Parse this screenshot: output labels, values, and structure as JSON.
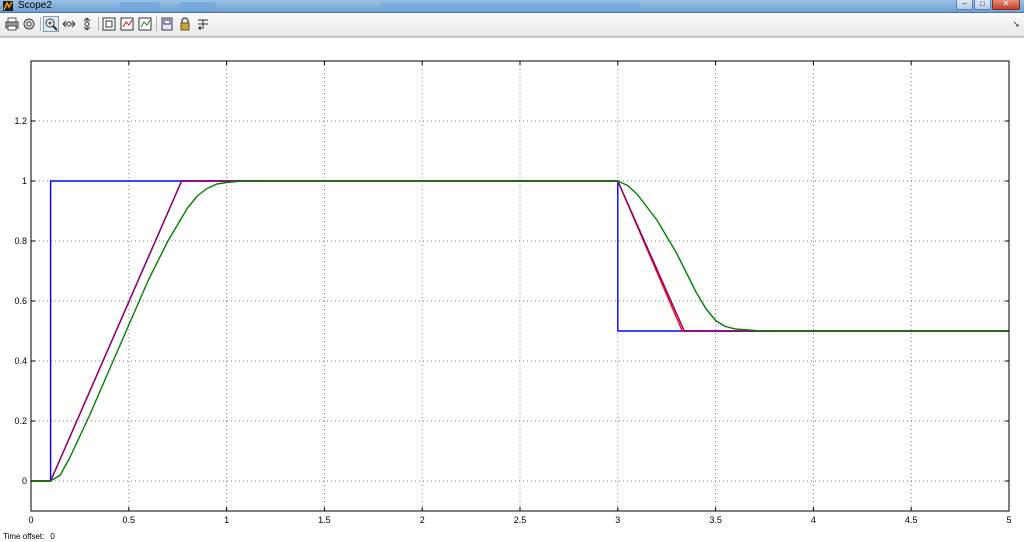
{
  "window": {
    "title": "Scope2",
    "controls": [
      "–",
      "□",
      "✕"
    ]
  },
  "toolbar": {
    "buttons": [
      {
        "icon": "print-icon",
        "tooltip": "Print"
      },
      {
        "icon": "parameters-icon",
        "tooltip": "Parameters"
      },
      {
        "icon": "zoom-icon",
        "tooltip": "Zoom",
        "active": true
      },
      {
        "icon": "zoom-x-icon",
        "tooltip": "Zoom X-axis"
      },
      {
        "icon": "zoom-y-icon",
        "tooltip": "Zoom Y-axis"
      },
      {
        "icon": "autoscale-icon",
        "tooltip": "Autoscale"
      },
      {
        "icon": "save-axes-icon",
        "tooltip": "Save current axes settings"
      },
      {
        "icon": "restore-axes-icon",
        "tooltip": "Restore saved axes settings"
      },
      {
        "icon": "floating-scope-icon",
        "tooltip": "Floating scope"
      },
      {
        "icon": "lock-axes-icon",
        "tooltip": "Lock axes selection"
      },
      {
        "icon": "signal-selector-icon",
        "tooltip": "Signal selection"
      }
    ]
  },
  "status": {
    "time_offset_label": "Time offset:",
    "time_offset_value": "0"
  },
  "chart_data": {
    "type": "line",
    "title": "",
    "xlabel": "",
    "ylabel": "",
    "xlim": [
      0,
      5
    ],
    "ylim": [
      -0.1,
      1.4
    ],
    "xticks": [
      "0",
      "0.5",
      "1",
      "1.5",
      "2",
      "2.5",
      "3",
      "3.5",
      "4",
      "4.5",
      "5"
    ],
    "yticks": [
      "0",
      "0.2",
      "0.4",
      "0.6",
      "0.8",
      "1",
      "1.2"
    ],
    "xtick_values": [
      0,
      0.5,
      1,
      1.5,
      2,
      2.5,
      3,
      3.5,
      4,
      4.5,
      5
    ],
    "ytick_values": [
      0,
      0.2,
      0.4,
      0.6,
      0.8,
      1,
      1.2
    ],
    "grid": true,
    "grid_style": "dotted",
    "background": "#ffffff",
    "series": [
      {
        "color": "#0000ff",
        "x": [
          0,
          0.1,
          0.1,
          3.0,
          3.0,
          5.0
        ],
        "y": [
          0,
          0,
          1,
          1,
          0.5,
          0.5
        ]
      },
      {
        "color": "#ff0000",
        "x": [
          0,
          0.1,
          0.77,
          3.0,
          3.33,
          5.0
        ],
        "y": [
          0,
          0,
          1,
          1,
          0.5,
          0.5
        ]
      },
      {
        "color": "#800080",
        "x": [
          0,
          0.1,
          0.77,
          1.2,
          3.0,
          3.34,
          3.75,
          5.0
        ],
        "y": [
          0,
          0,
          1,
          1,
          1,
          0.5,
          0.5,
          0.5
        ]
      },
      {
        "color": "#008000",
        "x": [
          0,
          0.1,
          0.15,
          0.2,
          0.3,
          0.4,
          0.5,
          0.6,
          0.7,
          0.8,
          0.85,
          0.9,
          0.95,
          1.0,
          1.05,
          1.1,
          1.2,
          3.0,
          3.05,
          3.1,
          3.2,
          3.3,
          3.4,
          3.45,
          3.5,
          3.55,
          3.6,
          3.7,
          3.75,
          5.0
        ],
        "y": [
          0,
          0,
          0.02,
          0.08,
          0.22,
          0.37,
          0.52,
          0.67,
          0.8,
          0.91,
          0.95,
          0.975,
          0.99,
          0.995,
          0.998,
          1.0,
          1.0,
          1.0,
          0.985,
          0.955,
          0.87,
          0.76,
          0.63,
          0.575,
          0.535,
          0.515,
          0.507,
          0.502,
          0.5,
          0.5
        ]
      }
    ]
  }
}
